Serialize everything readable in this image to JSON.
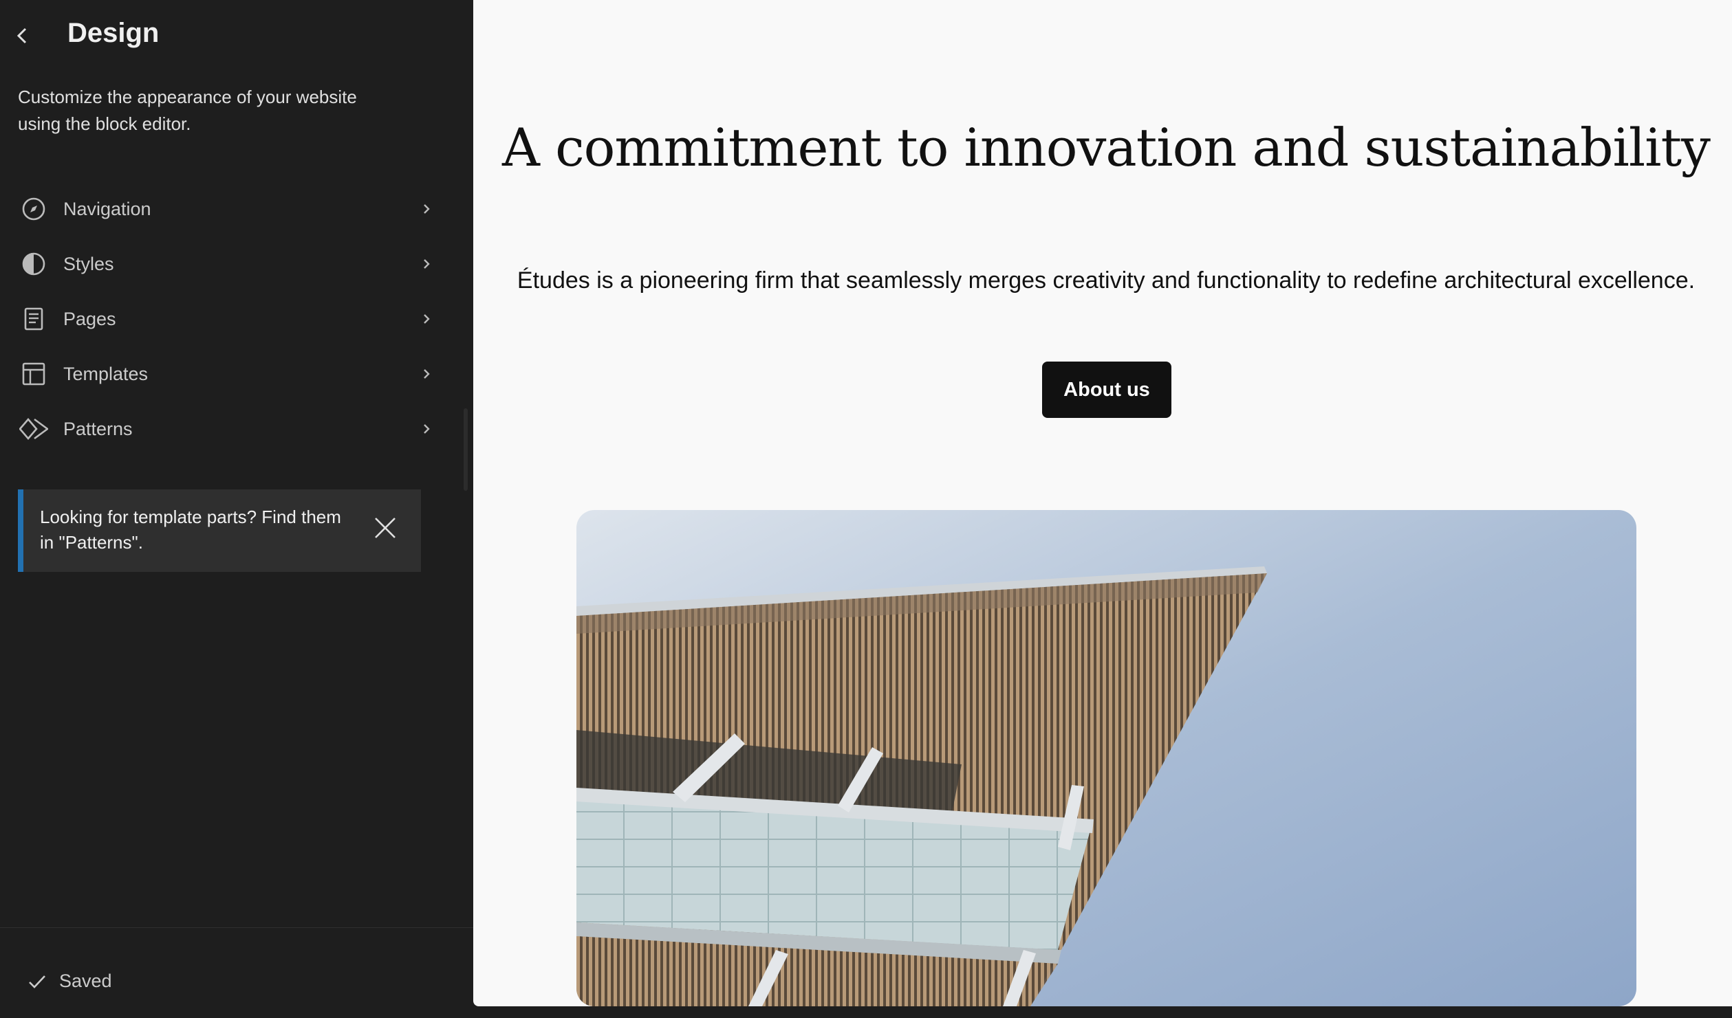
{
  "sidebar": {
    "title": "Design",
    "description": "Customize the appearance of your website using the block editor.",
    "items": [
      {
        "label": "Navigation",
        "icon": "compass-icon"
      },
      {
        "label": "Styles",
        "icon": "half-circle-icon"
      },
      {
        "label": "Pages",
        "icon": "page-icon"
      },
      {
        "label": "Templates",
        "icon": "layout-icon"
      },
      {
        "label": "Patterns",
        "icon": "diamond-icon"
      }
    ],
    "notice": {
      "text": "Looking for template parts? Find them in \"Patterns\"."
    },
    "footer": {
      "status": "Saved"
    }
  },
  "preview": {
    "heading": "A commitment to innovation and sustainability",
    "subheading": "Études is a pioneering firm that seamlessly merges creativity and functionality to redefine architectural excellence.",
    "button_label": "About us",
    "image": "building-photo"
  },
  "colors": {
    "sidebar_bg": "#1e1e1e",
    "notice_accent": "#2271b1",
    "preview_bg": "#f9f9f9",
    "button_bg": "#111111"
  }
}
